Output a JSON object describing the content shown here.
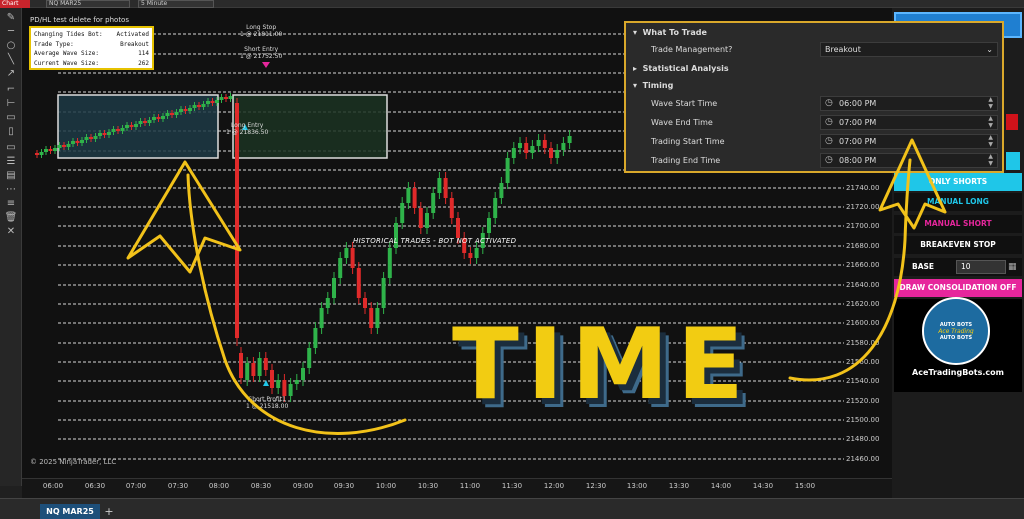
{
  "window": {
    "chart_tab": "Chart",
    "instrument": "NQ MAR25",
    "timeframe": "5 Minute"
  },
  "chart": {
    "title": "PD/HL test delete for photos",
    "copyright": "© 2025 NinjaTrader, LLC",
    "historical_note": "HISTORICAL TRADES - BOT NOT ACTIVATED",
    "overlay_text": "TIME",
    "instrument_tab": "NQ MAR25",
    "add_tab": "+"
  },
  "info_box": {
    "rows": [
      {
        "label": "Changing Tides Bot:",
        "value": "Activated"
      },
      {
        "label": "Trade Type:",
        "value": "Breakout"
      },
      {
        "label": "Average Wave Size:",
        "value": "114"
      },
      {
        "label": "Current Wave Size:",
        "value": "262"
      }
    ]
  },
  "order_labels": {
    "long_stop_title": "Long Stop",
    "long_stop_value": "1 @ 21811.00",
    "short_entry_title": "Short Entry",
    "short_entry_value": "1 @ 21752.50",
    "long_entry_title": "Long Entry",
    "long_entry_value": "1 @ 21836.50",
    "short_profit_title": "Short Profit1",
    "short_profit_value": "1 @ 21518.00"
  },
  "price_axis": [
    "21740.00",
    "21720.00",
    "21700.00",
    "21680.00",
    "21660.00",
    "21640.00",
    "21620.00",
    "21600.00",
    "21580.00",
    "21560.00",
    "21540.00",
    "21520.00",
    "21500.00",
    "21480.00",
    "21460.00"
  ],
  "time_axis": [
    "06:00",
    "06:30",
    "07:00",
    "07:30",
    "08:00",
    "08:30",
    "09:00",
    "09:30",
    "10:00",
    "10:30",
    "11:00",
    "11:30",
    "12:00",
    "12:30",
    "13:00",
    "13:30",
    "14:00",
    "14:30",
    "15:00"
  ],
  "settings_panel": {
    "category_what": "What To Trade",
    "trade_mgmt_label": "Trade Management?",
    "trade_mgmt_value": "Breakout",
    "category_stats": "Statistical Analysis",
    "category_timing": "Timing",
    "wave_start_label": "Wave Start Time",
    "wave_start_value": "06:00 PM",
    "wave_end_label": "Wave End Time",
    "wave_end_value": "07:00 PM",
    "trading_start_label": "Trading Start Time",
    "trading_start_value": "07:00 PM",
    "trading_end_label": "Trading End Time",
    "trading_end_value": "08:00 PM"
  },
  "right_panel": {
    "shorts_btn": "ONLY SHORTS",
    "long_btn": "MANUAL LONG",
    "manual_short_btn": "MANUAL SHORT",
    "breakeven_btn": "BREAKEVEN STOP",
    "base_label": "BASE",
    "base_value": "10",
    "consolidation_btn": "DRAW CONSOLIDATION OFF",
    "logo_top": "AUTO BOTS",
    "logo_mid": "Ace Trading",
    "logo_bottom": "AUTO BOTS",
    "site": "AceTradingBots.com"
  },
  "colors": {
    "up": "#2fb34a",
    "down": "#e02a2a",
    "accent": "#f2cc12",
    "cyan": "#1fc6e8",
    "magenta": "#e6269c"
  }
}
